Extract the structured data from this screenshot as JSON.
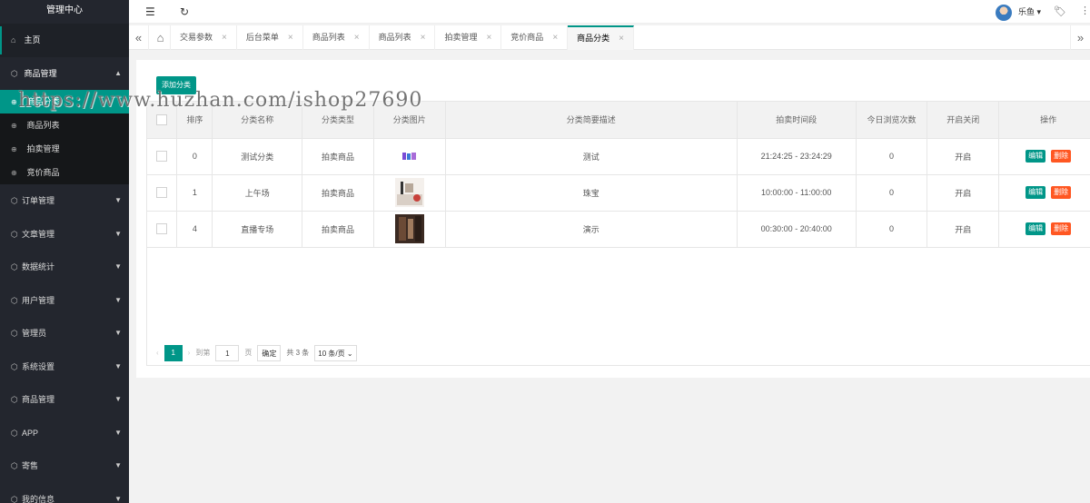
{
  "sidebar": {
    "title": "管理中心",
    "items": [
      {
        "label": "主页",
        "icon": "home-icon"
      },
      {
        "label": "商品管理",
        "icon": "box-icon",
        "open": true
      },
      {
        "label": "订单管理",
        "icon": "box-icon"
      },
      {
        "label": "文章管理",
        "icon": "box-icon"
      },
      {
        "label": "数据统计",
        "icon": "box-icon"
      },
      {
        "label": "用户管理",
        "icon": "box-icon"
      },
      {
        "label": "管理员",
        "icon": "box-icon"
      },
      {
        "label": "系统设置",
        "icon": "box-icon"
      },
      {
        "label": "商品管理",
        "icon": "box-icon"
      },
      {
        "label": "APP",
        "icon": "box-icon"
      },
      {
        "label": "寄售",
        "icon": "box-icon"
      },
      {
        "label": "我的信息",
        "icon": "box-icon"
      }
    ],
    "sub_items": [
      {
        "label": "商品分类",
        "active": true
      },
      {
        "label": "商品列表"
      },
      {
        "label": "拍卖管理"
      },
      {
        "label": "竞价商品"
      }
    ]
  },
  "header": {
    "user_name": "乐鱼"
  },
  "tabs": [
    {
      "label": "交易参数"
    },
    {
      "label": "后台菜单"
    },
    {
      "label": "商品列表"
    },
    {
      "label": "商品列表"
    },
    {
      "label": "拍卖管理"
    },
    {
      "label": "竞价商品"
    },
    {
      "label": "商品分类",
      "active": true
    }
  ],
  "main": {
    "add_button": "添加分类",
    "columns": [
      "排序",
      "分类名称",
      "分类类型",
      "分类图片",
      "分类简要描述",
      "拍卖时间段",
      "今日浏览次数",
      "开启关闭",
      "操作"
    ],
    "rows": [
      {
        "sort": "0",
        "name": "测试分类",
        "type": "拍卖商品",
        "desc": "测试",
        "time": "21:24:25 - 23:24:29",
        "views": "0",
        "status": "开启"
      },
      {
        "sort": "1",
        "name": "上午场",
        "type": "拍卖商品",
        "desc": "珠宝",
        "time": "10:00:00 - 11:00:00",
        "views": "0",
        "status": "开启"
      },
      {
        "sort": "4",
        "name": "直播专场",
        "type": "拍卖商品",
        "desc": "演示",
        "time": "00:30:00 - 20:40:00",
        "views": "0",
        "status": "开启"
      }
    ],
    "edit_label": "编辑",
    "delete_label": "删除",
    "pagination": {
      "current_page": "1",
      "goto_label": "到第",
      "goto_value": "1",
      "page_unit": "页",
      "confirm_label": "确定",
      "total": "共 3 条",
      "page_size": "10 条/页"
    }
  },
  "watermark": "https://www.huzhan.com/ishop27690",
  "colors": {
    "accent": "#009688",
    "danger": "#ff5722",
    "sidebar": "#23262e"
  }
}
